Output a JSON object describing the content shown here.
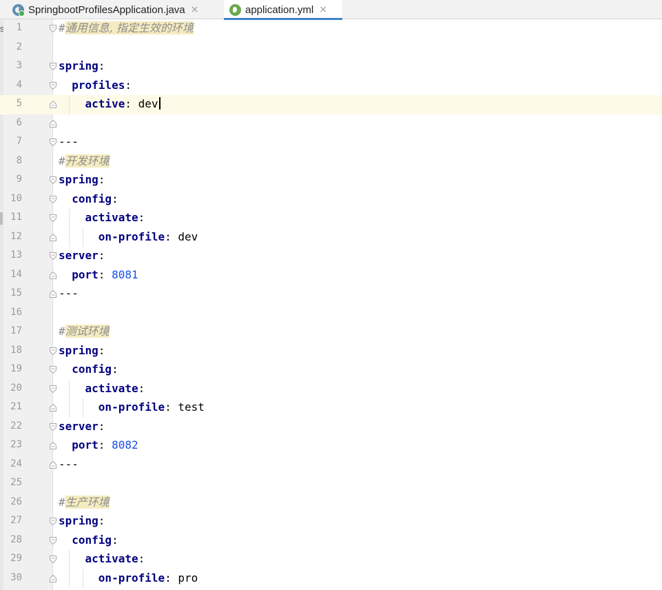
{
  "tabs": [
    {
      "label": "SpringbootProfilesApplication.java",
      "icon": "spring-class-icon",
      "active": false
    },
    {
      "label": "application.yml",
      "icon": "spring-yaml-icon",
      "active": true
    }
  ],
  "edge_text": "s",
  "close_glyph": "×",
  "current_line": 5,
  "lines": [
    {
      "n": "1",
      "tokens": [
        {
          "t": "#",
          "c": "hash"
        },
        {
          "t": "通用信息, ",
          "c": "comment"
        },
        {
          "t": "指定生效的环境",
          "c": "comment"
        }
      ],
      "fold": "open",
      "indent": 0
    },
    {
      "n": "2",
      "tokens": [],
      "fold": "",
      "indent": 0
    },
    {
      "n": "3",
      "tokens": [
        {
          "t": "spring",
          "c": "key"
        },
        {
          "t": ":",
          "c": "colon"
        }
      ],
      "fold": "open",
      "indent": 0
    },
    {
      "n": "4",
      "tokens": [
        {
          "t": "  "
        },
        {
          "t": "profiles",
          "c": "key"
        },
        {
          "t": ":",
          "c": "colon"
        }
      ],
      "fold": "open",
      "indent": 1
    },
    {
      "n": "5",
      "tokens": [
        {
          "t": "    "
        },
        {
          "t": "active",
          "c": "key"
        },
        {
          "t": ": ",
          "c": "colon"
        },
        {
          "t": "dev",
          "c": "val"
        }
      ],
      "fold": "close",
      "indent": 2,
      "caret": true
    },
    {
      "n": "6",
      "tokens": [],
      "fold": "close",
      "indent": 0
    },
    {
      "n": "7",
      "tokens": [
        {
          "t": "---",
          "c": "dash"
        }
      ],
      "fold": "open",
      "indent": 0
    },
    {
      "n": "8",
      "tokens": [
        {
          "t": "#",
          "c": "hash"
        },
        {
          "t": "开发环境",
          "c": "comment"
        }
      ],
      "fold": "",
      "indent": 0
    },
    {
      "n": "9",
      "tokens": [
        {
          "t": "spring",
          "c": "key"
        },
        {
          "t": ":",
          "c": "colon"
        }
      ],
      "fold": "open",
      "indent": 0
    },
    {
      "n": "10",
      "tokens": [
        {
          "t": "  "
        },
        {
          "t": "config",
          "c": "key"
        },
        {
          "t": ":",
          "c": "colon"
        }
      ],
      "fold": "open",
      "indent": 1
    },
    {
      "n": "11",
      "tokens": [
        {
          "t": "    "
        },
        {
          "t": "activate",
          "c": "key"
        },
        {
          "t": ":",
          "c": "colon"
        }
      ],
      "fold": "open",
      "indent": 2
    },
    {
      "n": "12",
      "tokens": [
        {
          "t": "      "
        },
        {
          "t": "on-profile",
          "c": "key"
        },
        {
          "t": ": ",
          "c": "colon"
        },
        {
          "t": "dev",
          "c": "val"
        }
      ],
      "fold": "close",
      "indent": 3
    },
    {
      "n": "13",
      "tokens": [
        {
          "t": "server",
          "c": "key"
        },
        {
          "t": ":",
          "c": "colon"
        }
      ],
      "fold": "open",
      "indent": 0
    },
    {
      "n": "14",
      "tokens": [
        {
          "t": "  "
        },
        {
          "t": "port",
          "c": "key"
        },
        {
          "t": ": ",
          "c": "colon"
        },
        {
          "t": "8081",
          "c": "num"
        }
      ],
      "fold": "close",
      "indent": 1
    },
    {
      "n": "15",
      "tokens": [
        {
          "t": "---",
          "c": "dash"
        }
      ],
      "fold": "close",
      "indent": 0
    },
    {
      "n": "16",
      "tokens": [],
      "fold": "",
      "indent": 0
    },
    {
      "n": "17",
      "tokens": [
        {
          "t": "#",
          "c": "hash"
        },
        {
          "t": "测试环境",
          "c": "comment"
        }
      ],
      "fold": "",
      "indent": 0
    },
    {
      "n": "18",
      "tokens": [
        {
          "t": "spring",
          "c": "key"
        },
        {
          "t": ":",
          "c": "colon"
        }
      ],
      "fold": "open",
      "indent": 0
    },
    {
      "n": "19",
      "tokens": [
        {
          "t": "  "
        },
        {
          "t": "config",
          "c": "key"
        },
        {
          "t": ":",
          "c": "colon"
        }
      ],
      "fold": "open",
      "indent": 1
    },
    {
      "n": "20",
      "tokens": [
        {
          "t": "    "
        },
        {
          "t": "activate",
          "c": "key"
        },
        {
          "t": ":",
          "c": "colon"
        }
      ],
      "fold": "open",
      "indent": 2
    },
    {
      "n": "21",
      "tokens": [
        {
          "t": "      "
        },
        {
          "t": "on-profile",
          "c": "key"
        },
        {
          "t": ": ",
          "c": "colon"
        },
        {
          "t": "test",
          "c": "val"
        }
      ],
      "fold": "close",
      "indent": 3
    },
    {
      "n": "22",
      "tokens": [
        {
          "t": "server",
          "c": "key"
        },
        {
          "t": ":",
          "c": "colon"
        }
      ],
      "fold": "open",
      "indent": 0
    },
    {
      "n": "23",
      "tokens": [
        {
          "t": "  "
        },
        {
          "t": "port",
          "c": "key"
        },
        {
          "t": ": ",
          "c": "colon"
        },
        {
          "t": "8082",
          "c": "num"
        }
      ],
      "fold": "close",
      "indent": 1
    },
    {
      "n": "24",
      "tokens": [
        {
          "t": "---",
          "c": "dash"
        }
      ],
      "fold": "close",
      "indent": 0
    },
    {
      "n": "25",
      "tokens": [],
      "fold": "",
      "indent": 0
    },
    {
      "n": "26",
      "tokens": [
        {
          "t": "#",
          "c": "hash"
        },
        {
          "t": "生产环境",
          "c": "comment"
        }
      ],
      "fold": "",
      "indent": 0
    },
    {
      "n": "27",
      "tokens": [
        {
          "t": "spring",
          "c": "key"
        },
        {
          "t": ":",
          "c": "colon"
        }
      ],
      "fold": "open",
      "indent": 0
    },
    {
      "n": "28",
      "tokens": [
        {
          "t": "  "
        },
        {
          "t": "config",
          "c": "key"
        },
        {
          "t": ":",
          "c": "colon"
        }
      ],
      "fold": "open",
      "indent": 1
    },
    {
      "n": "29",
      "tokens": [
        {
          "t": "    "
        },
        {
          "t": "activate",
          "c": "key"
        },
        {
          "t": ":",
          "c": "colon"
        }
      ],
      "fold": "open",
      "indent": 2
    },
    {
      "n": "30",
      "tokens": [
        {
          "t": "      "
        },
        {
          "t": "on-profile",
          "c": "key"
        },
        {
          "t": ": ",
          "c": "colon"
        },
        {
          "t": "pro",
          "c": "val"
        }
      ],
      "fold": "close",
      "indent": 3
    }
  ]
}
